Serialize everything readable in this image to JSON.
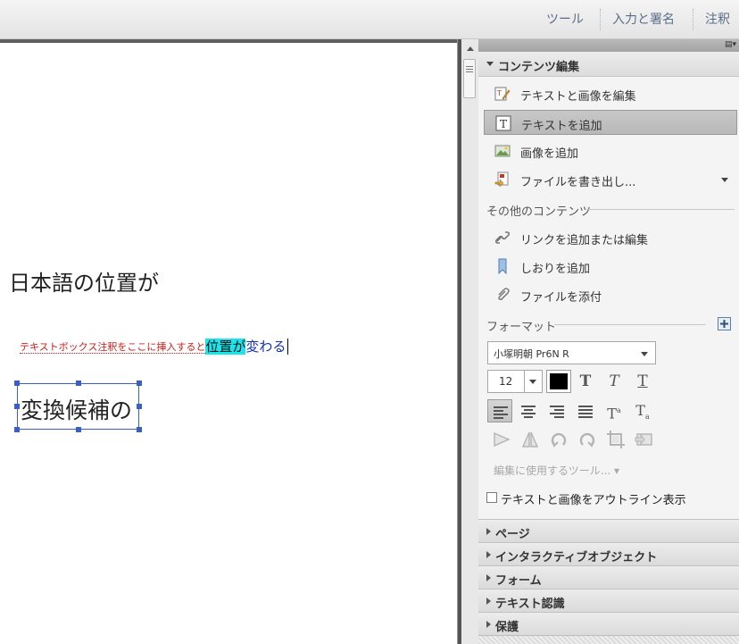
{
  "topbar": {
    "tools_label": "ツール",
    "sign_label": "入力と署名",
    "comment_label": "注釈"
  },
  "document": {
    "heading": "日本語の位置が",
    "annotation_note": "テキストボックス注釈をここに挿入すると",
    "highlighted_text": "位置が",
    "changed_text": "変わる",
    "textbox_text": "変換候補の"
  },
  "panel": {
    "content_edit_title": "コンテンツ編集",
    "tools": [
      {
        "label": "テキストと画像を編集"
      },
      {
        "label": "テキストを追加"
      },
      {
        "label": "画像を追加"
      },
      {
        "label": "ファイルを書き出し..."
      }
    ],
    "other_content_title": "その他のコンテンツ",
    "other_tools": [
      {
        "label": "リンクを追加または編集"
      },
      {
        "label": "しおりを追加"
      },
      {
        "label": "ファイルを添付"
      }
    ],
    "format_title": "フォーマット",
    "font_name": "小塚明朝 Pr6N R",
    "font_size": "12",
    "font_color": "#000000",
    "edit_tools_label": "編集に使用するツール... ▾",
    "outline_label": "テキストと画像をアウトライン表示",
    "collapsed_sections": [
      {
        "label": "ページ"
      },
      {
        "label": "インタラクティブオブジェクト"
      },
      {
        "label": "フォーム"
      },
      {
        "label": "テキスト認識"
      },
      {
        "label": "保護"
      }
    ]
  },
  "colors": {
    "highlight": "#18e6ec",
    "annotation_red": "#d21b1b",
    "changed_blue": "#1530b0",
    "selection_border": "#3b5fc4",
    "tab_text": "#5a6e8a"
  }
}
